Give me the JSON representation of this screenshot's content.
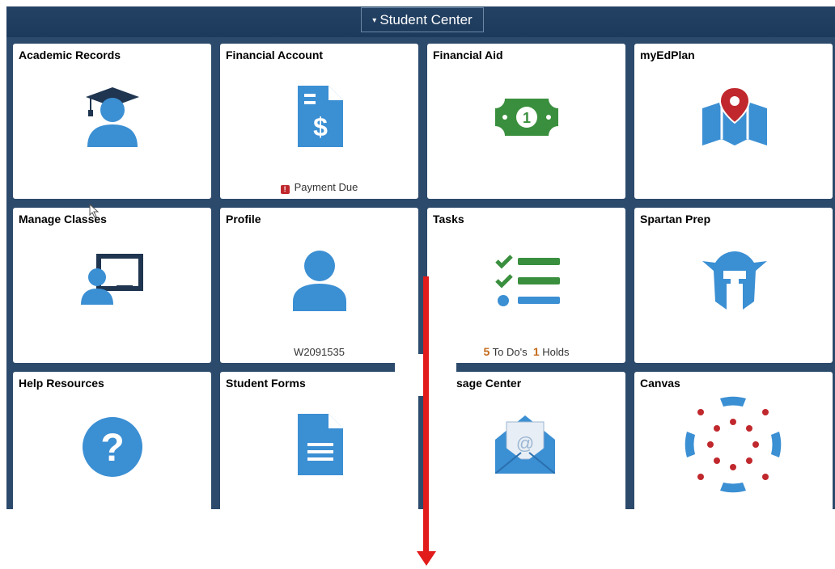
{
  "header": {
    "title": "Student Center",
    "caret": "▾"
  },
  "tiles": [
    {
      "title": "Academic Records",
      "icon": "graduate-icon"
    },
    {
      "title": "Financial Account",
      "icon": "invoice-dollar-icon",
      "footer": "Payment Due",
      "alert_glyph": "!"
    },
    {
      "title": "Financial Aid",
      "icon": "money-bill-icon"
    },
    {
      "title": "myEdPlan",
      "icon": "map-pin-icon"
    },
    {
      "title": "Manage Classes",
      "icon": "classroom-icon"
    },
    {
      "title": "Profile",
      "icon": "user-icon",
      "footer": "W2091535"
    },
    {
      "title": "Tasks",
      "icon": "checklist-icon",
      "todo_count": "5",
      "todo_label": "To Do's",
      "holds_count": "1",
      "holds_label": "Holds"
    },
    {
      "title": "Spartan Prep",
      "icon": "spartan-helmet-icon"
    },
    {
      "title": "Help Resources",
      "icon": "question-icon"
    },
    {
      "title": "Student Forms",
      "icon": "document-icon"
    },
    {
      "title": "sage Center",
      "icon": "envelope-icon"
    },
    {
      "title": "Canvas",
      "icon": "canvas-logo-icon"
    }
  ],
  "colors": {
    "icon_blue": "#3b8fd3",
    "icon_green": "#3a8f3e",
    "alert_red": "#c0282d",
    "count_orange": "#c46a18",
    "arrow_red": "#e21b1b",
    "header_navy": "#1c3a5c"
  }
}
